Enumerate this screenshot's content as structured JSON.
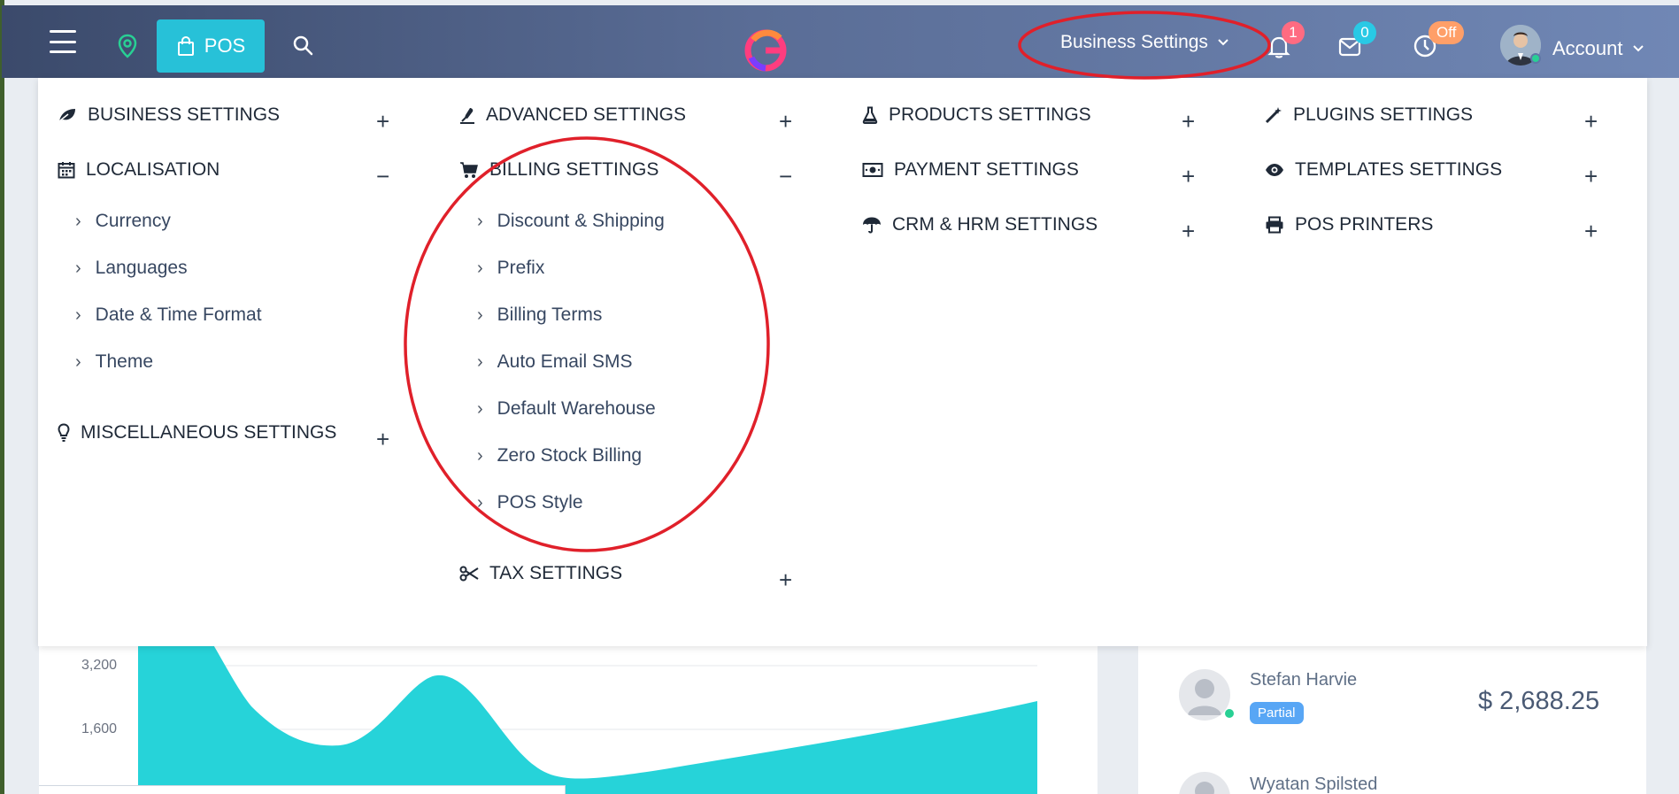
{
  "topbar": {
    "pos_label": "POS",
    "business_settings_label": "Business Settings",
    "notifications_count": "1",
    "messages_count": "0",
    "clock_status": "Off",
    "account_label": "Account"
  },
  "menu": {
    "col1": {
      "business_settings": "BUSINESS SETTINGS",
      "localisation": "LOCALISATION",
      "currency": "Currency",
      "languages": "Languages",
      "date_time_format": "Date & Time Format",
      "theme": "Theme",
      "misc_settings": "MISCELLANEOUS SETTINGS"
    },
    "col2": {
      "advanced_settings": "ADVANCED SETTINGS",
      "billing_settings": "BILLING SETTINGS",
      "discount_shipping": "Discount & Shipping",
      "prefix": "Prefix",
      "billing_terms": "Billing Terms",
      "auto_email_sms": "Auto Email SMS",
      "default_warehouse": "Default Warehouse",
      "zero_stock_billing": "Zero Stock Billing",
      "pos_style": "POS Style",
      "tax_settings": "TAX SETTINGS"
    },
    "col3": {
      "products_settings": "PRODUCTS SETTINGS",
      "payment_settings": "PAYMENT SETTINGS",
      "crm_hrm_settings": "CRM & HRM SETTINGS"
    },
    "col4": {
      "plugins_settings": "PLUGINS SETTINGS",
      "templates_settings": "TEMPLATES SETTINGS",
      "pos_printers": "POS PRINTERS"
    },
    "expand_symbol": "+",
    "collapse_symbol": "−",
    "chevron_symbol": "›"
  },
  "chart": {
    "tick_high": "3,200",
    "tick_mid": "1,600"
  },
  "customers": {
    "first_name": "Stefan Harvie",
    "first_status": "Partial",
    "first_amount": "$ 2,688.25",
    "second_name": "Wyatan Spilsted"
  },
  "colors": {
    "accent": "#27c1d8",
    "annotation": "#e0202a",
    "chart_fill": "#26d3d9"
  }
}
